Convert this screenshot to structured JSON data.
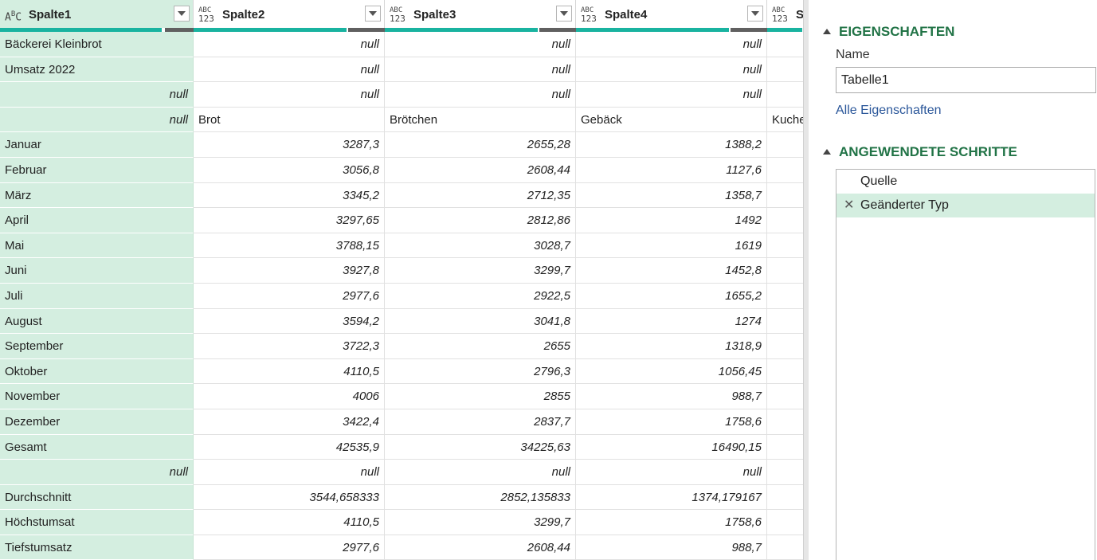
{
  "columns": [
    {
      "name": "Spalte1",
      "type": "text",
      "type_label_top": "A",
      "type_label_b": "B",
      "type_label_c": "C",
      "ok": 203,
      "bad": 36
    },
    {
      "name": "Spalte2",
      "type": "any",
      "type_label_top": "ABC",
      "type_label_bottom": "123",
      "ok": 192,
      "bad": 46
    },
    {
      "name": "Spalte3",
      "type": "any",
      "type_label_top": "ABC",
      "type_label_bottom": "123",
      "ok": 192,
      "bad": 46
    },
    {
      "name": "Spalte4",
      "type": "any",
      "type_label_top": "ABC",
      "type_label_bottom": "123",
      "ok": 192,
      "bad": 46
    },
    {
      "name": "S",
      "type": "any",
      "type_label_top": "ABC",
      "type_label_bottom": "123",
      "ok": 44,
      "bad": 0
    }
  ],
  "rows": [
    [
      "Bäckerei Kleinbrot",
      "null",
      "null",
      "null",
      ""
    ],
    [
      "Umsatz 2022",
      "null",
      "null",
      "null",
      ""
    ],
    [
      "null",
      "null",
      "null",
      "null",
      ""
    ],
    [
      "null",
      "Brot",
      "Brötchen",
      "Gebäck",
      "Kuche"
    ],
    [
      "Januar",
      "3287,3",
      "2655,28",
      "1388,2",
      ""
    ],
    [
      "Februar",
      "3056,8",
      "2608,44",
      "1127,6",
      ""
    ],
    [
      "März",
      "3345,2",
      "2712,35",
      "1358,7",
      ""
    ],
    [
      "April",
      "3297,65",
      "2812,86",
      "1492",
      ""
    ],
    [
      "Mai",
      "3788,15",
      "3028,7",
      "1619",
      ""
    ],
    [
      "Juni",
      "3927,8",
      "3299,7",
      "1452,8",
      ""
    ],
    [
      "Juli",
      "2977,6",
      "2922,5",
      "1655,2",
      ""
    ],
    [
      "August",
      "3594,2",
      "3041,8",
      "1274",
      ""
    ],
    [
      "September",
      "3722,3",
      "2655",
      "1318,9",
      ""
    ],
    [
      "Oktober",
      "4110,5",
      "2796,3",
      "1056,45",
      ""
    ],
    [
      "November",
      "4006",
      "2855",
      "988,7",
      ""
    ],
    [
      "Dezember",
      "3422,4",
      "2837,7",
      "1758,6",
      ""
    ],
    [
      "Gesamt",
      "42535,9",
      "34225,63",
      "16490,15",
      ""
    ],
    [
      "null",
      "null",
      "null",
      "null",
      ""
    ],
    [
      "Durchschnitt",
      "3544,658333",
      "2852,135833",
      "1374,179167",
      ""
    ],
    [
      "Höchstumsat",
      "4110,5",
      "3299,7",
      "1758,6",
      ""
    ],
    [
      "Tiefstumsatz",
      "2977,6",
      "2608,44",
      "988,7",
      ""
    ]
  ],
  "pane": {
    "properties_title": "EIGENSCHAFTEN",
    "name_label": "Name",
    "name_value": "Tabelle1",
    "all_properties": "Alle Eigenschaften",
    "steps_title": "ANGEWENDETE SCHRITTE",
    "steps": [
      {
        "label": "Quelle",
        "selected": false
      },
      {
        "label": "Geänderter Typ",
        "selected": true
      }
    ],
    "delete_glyph": "✕"
  },
  "colors": {
    "accent": "#217346",
    "quality_ok": "#19b3a0",
    "quality_bad": "#606060",
    "selection": "#d4eee0",
    "link": "#2b579a"
  }
}
